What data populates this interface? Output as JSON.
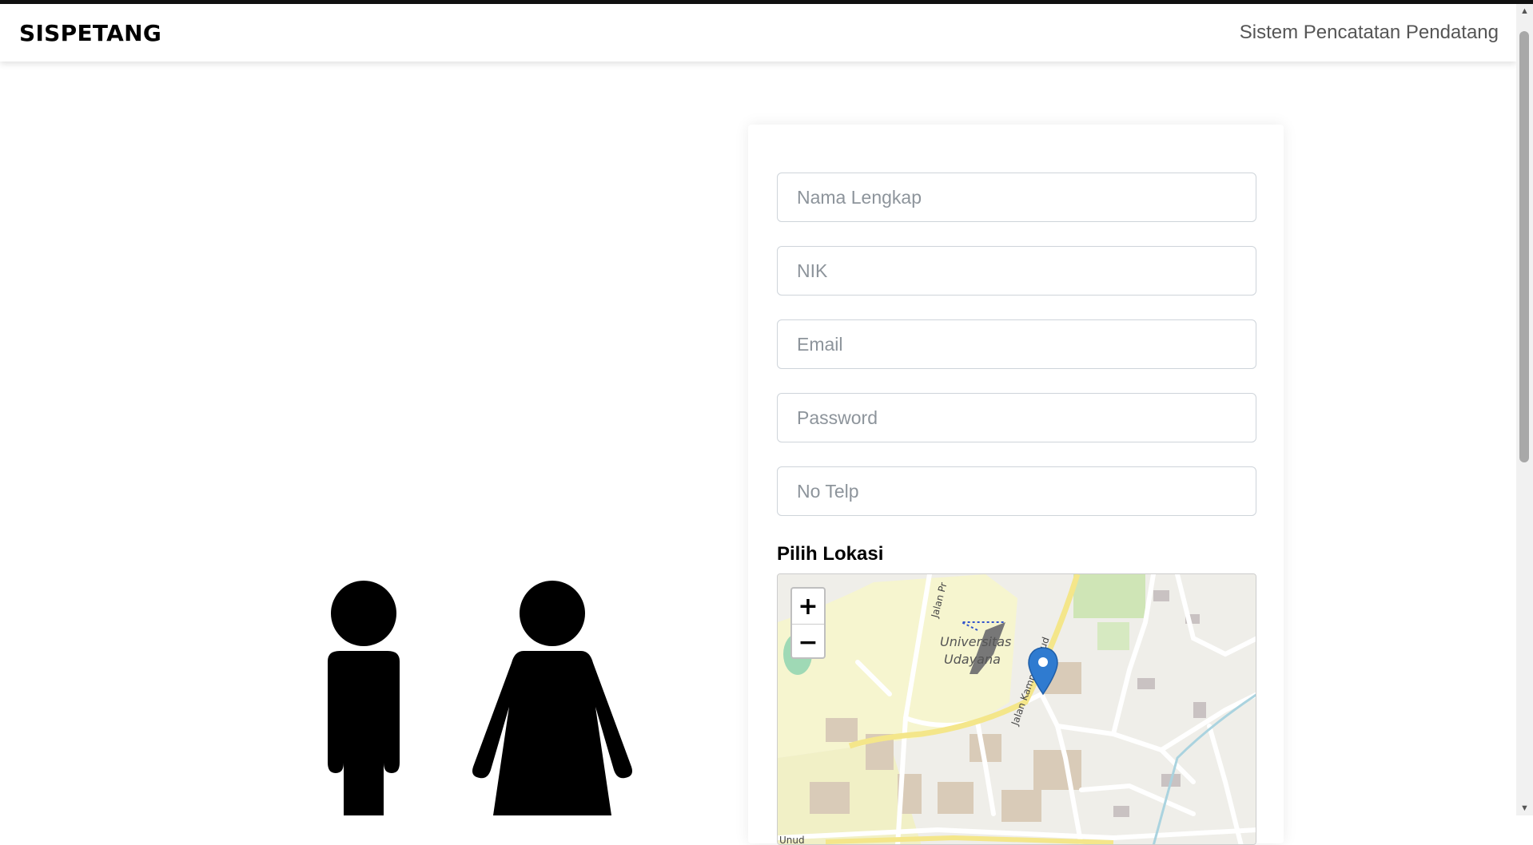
{
  "navbar": {
    "brand": "SISPETANG",
    "tagline": "Sistem Pencatatan Pendatang"
  },
  "form": {
    "fields": [
      {
        "placeholder": "Nama Lengkap",
        "value": ""
      },
      {
        "placeholder": "NIK",
        "value": ""
      },
      {
        "placeholder": "Email",
        "value": ""
      },
      {
        "placeholder": "Password",
        "value": ""
      },
      {
        "placeholder": "No Telp",
        "value": ""
      }
    ],
    "location_label": "Pilih Lokasi"
  },
  "map": {
    "zoom_in": "+",
    "zoom_out": "−",
    "labels": [
      "Universitas",
      "Udayana",
      "Jalan Kampus Unud",
      "Jalan Pr",
      "Unud"
    ]
  }
}
